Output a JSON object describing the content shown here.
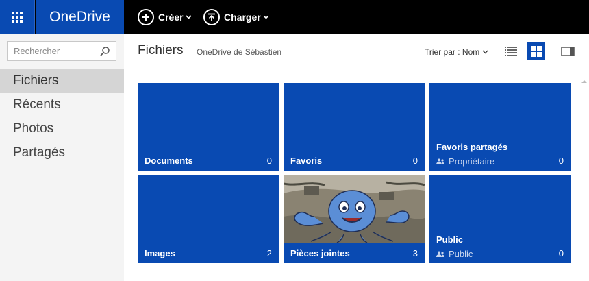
{
  "app": {
    "name": "OneDrive",
    "accent": "#094ab2"
  },
  "toolbar": {
    "create_label": "Créer",
    "upload_label": "Charger"
  },
  "sidebar": {
    "search_placeholder": "Rechercher",
    "items": [
      {
        "label": "Fichiers",
        "active": true
      },
      {
        "label": "Récents"
      },
      {
        "label": "Photos"
      },
      {
        "label": "Partagés"
      }
    ]
  },
  "header": {
    "title": "Fichiers",
    "breadcrumb": "OneDrive de Sébastien",
    "sort_label": "Trier par : Nom"
  },
  "tiles": [
    {
      "name": "Documents",
      "count": "0"
    },
    {
      "name": "Favoris",
      "count": "0"
    },
    {
      "name": "Favoris partagés",
      "sub": "Propriétaire",
      "count": "0"
    },
    {
      "name": "Images",
      "count": "2"
    },
    {
      "name": "Pièces jointes",
      "count": "3"
    },
    {
      "name": "Public",
      "sub": "Public",
      "count": "0"
    }
  ]
}
